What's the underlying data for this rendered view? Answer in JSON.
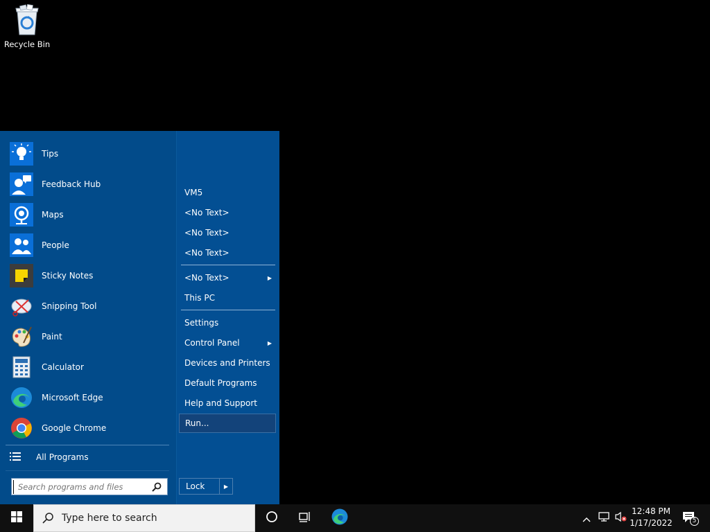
{
  "desktop": {
    "icons": [
      {
        "label": "Recycle Bin",
        "icon": "recycle-bin-icon"
      }
    ]
  },
  "start_menu": {
    "programs": [
      {
        "label": "Tips",
        "icon": "tips-lightbulb-icon"
      },
      {
        "label": "Feedback Hub",
        "icon": "feedback-hub-icon"
      },
      {
        "label": "Maps",
        "icon": "maps-icon"
      },
      {
        "label": "People",
        "icon": "people-icon"
      },
      {
        "label": "Sticky Notes",
        "icon": "sticky-notes-icon"
      },
      {
        "label": "Snipping Tool",
        "icon": "snipping-tool-icon"
      },
      {
        "label": "Paint",
        "icon": "paint-palette-icon"
      },
      {
        "label": "Calculator",
        "icon": "calculator-icon"
      },
      {
        "label": "Microsoft Edge",
        "icon": "edge-icon"
      },
      {
        "label": "Google Chrome",
        "icon": "chrome-icon"
      }
    ],
    "all_programs": "All Programs",
    "search_placeholder": "Search programs and files",
    "right_items": [
      {
        "label": "VM5"
      },
      {
        "label": "<No Text>"
      },
      {
        "label": "<No Text>"
      },
      {
        "label": "<No Text>"
      },
      {
        "label": "<No Text>",
        "submenu": true
      },
      {
        "label": "This PC"
      },
      {
        "label": "Settings"
      },
      {
        "label": "Control Panel",
        "submenu": true
      },
      {
        "label": "Devices and Printers"
      },
      {
        "label": "Default Programs"
      },
      {
        "label": "Help and Support"
      },
      {
        "label": "Run...",
        "highlighted": true
      }
    ],
    "lock_label": "Lock"
  },
  "taskbar": {
    "search_placeholder": "Type here to search",
    "clock_time": "12:48 PM",
    "clock_date": "1/17/2022",
    "notification_count": "5"
  },
  "colors": {
    "start_menu_bg": "#024b8a",
    "taskbar_bg": "#101010",
    "accent": "#0078d7"
  }
}
